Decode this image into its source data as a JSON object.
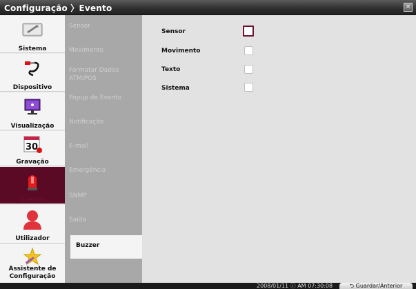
{
  "titlebar": {
    "title": "Configuração 〉Evento",
    "close": "×"
  },
  "sidebar": {
    "items": [
      {
        "label": "Sistema",
        "icon": "wrench-icon"
      },
      {
        "label": "Dispositivo",
        "icon": "cable-plug-icon"
      },
      {
        "label": "Visualização",
        "icon": "monitor-icon"
      },
      {
        "label": "Gravação",
        "icon": "calendar-icon"
      },
      {
        "label": "Evento",
        "icon": "siren-icon"
      },
      {
        "label": "Utilizador",
        "icon": "user-icon"
      },
      {
        "label": "Assistente de\nConfiguração",
        "icon": "wizard-star-icon"
      }
    ]
  },
  "calendar_day": "30",
  "submenu": {
    "items": [
      {
        "label": "Sensor"
      },
      {
        "label": "Movimento"
      },
      {
        "label": "Formatar Dados ATM/POS"
      },
      {
        "label": "Popup de Evento"
      },
      {
        "label": "Notificação"
      },
      {
        "label": "E-mail"
      },
      {
        "label": "Emergência"
      },
      {
        "label": "SNMP"
      },
      {
        "label": "Saída"
      }
    ],
    "active": "Buzzer"
  },
  "content": {
    "options": [
      {
        "label": "Sensor",
        "checked": false
      },
      {
        "label": "Movimento",
        "checked": false
      },
      {
        "label": "Texto",
        "checked": false
      },
      {
        "label": "Sistema",
        "checked": false
      }
    ]
  },
  "statusbar": {
    "datetime": "2008/01/11 ⓘ AM 07:30:08",
    "save_label": "Guardar/Anterior"
  },
  "colors": {
    "accent": "#6b1430",
    "active_tab": "#5b0a25"
  }
}
